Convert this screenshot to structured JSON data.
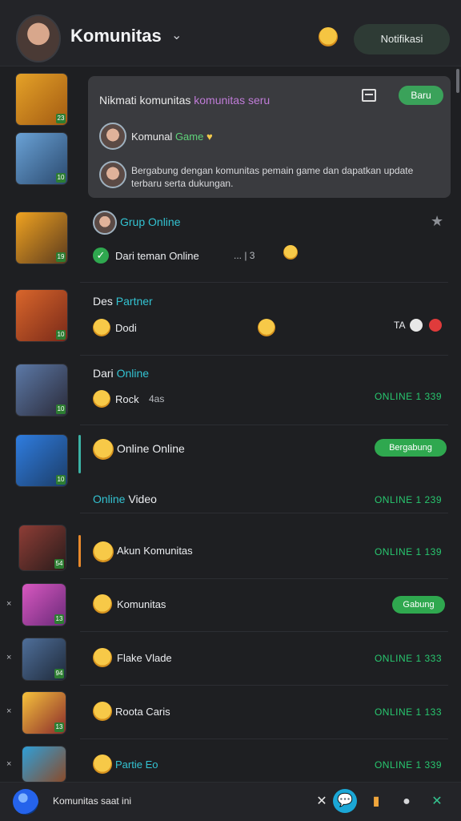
{
  "header": {
    "title": "Komunitas",
    "notifications_label": "Notifikasi"
  },
  "card": {
    "title": "Nikmati komunitas",
    "title_sub": "komunitas seru",
    "button": "Baru",
    "line1_name": "Komunal",
    "line1_status": "Game",
    "line2": "Bergabung dengan komunitas pemain game dan dapatkan update terbaru serta dukungan."
  },
  "rows": [
    {
      "name": "Grup Online",
      "message": "Dari teman Online",
      "extra": "... | 3",
      "timestamp": ""
    },
    {
      "name": "Des",
      "name_highlight": "Partner",
      "message": "Dodi",
      "extra": "TA",
      "timestamp": ""
    },
    {
      "name": "Dari",
      "name_highlight": "Online",
      "message": "Rock",
      "extra": "4as",
      "timestamp": "ONLINE 1 339"
    },
    {
      "name": "Online Online",
      "message": "",
      "extra": "",
      "timestamp": "",
      "pill": "Bergabung"
    },
    {
      "name": "Online",
      "name_highlight": "Video",
      "message": "",
      "extra": "",
      "timestamp": "ONLINE 1 239"
    },
    {
      "name": "Akun Komunitas",
      "message": "",
      "extra": "",
      "timestamp": "ONLINE 1 139"
    },
    {
      "name": "Komunitas",
      "message": "",
      "extra": "",
      "timestamp": "",
      "pill": "Gabung"
    },
    {
      "name": "Flake Vlade",
      "message": "",
      "extra": "",
      "timestamp": "ONLINE 1 333"
    },
    {
      "name": "Roota Caris",
      "message": "",
      "extra": "",
      "timestamp": "ONLINE 1 133"
    },
    {
      "name": "Partie Eo",
      "message": "",
      "extra": "",
      "timestamp": "ONLINE 1 339"
    }
  ],
  "icon_badges": [
    "23",
    "10",
    "19",
    "10",
    "10",
    "10",
    "54",
    "13",
    "94",
    "13"
  ],
  "bottom": {
    "label": "Komunitas saat ini"
  }
}
